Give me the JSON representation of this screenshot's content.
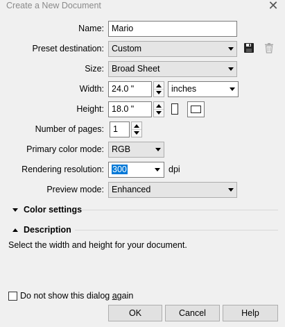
{
  "window": {
    "title": "Create a New Document",
    "close_glyph": "✕"
  },
  "form": {
    "name": {
      "label": "Name:",
      "value": "Mario"
    },
    "preset": {
      "label": "Preset destination:",
      "value": "Custom"
    },
    "size": {
      "label": "Size:",
      "value": "Broad Sheet"
    },
    "width": {
      "label": "Width:",
      "value": "24.0 \"",
      "unit": "inches"
    },
    "height": {
      "label": "Height:",
      "value": "18.0 \""
    },
    "pages": {
      "label": "Number of pages:",
      "value": "1"
    },
    "color_mode": {
      "label": "Primary color mode:",
      "value": "RGB"
    },
    "resolution": {
      "label": "Rendering resolution:",
      "value": "300",
      "unit": "dpi"
    },
    "preview": {
      "label": "Preview mode:",
      "value": "Enhanced"
    }
  },
  "sections": {
    "color_settings": "Color settings",
    "description": "Description",
    "description_text": "Select the width and height for your document."
  },
  "footer": {
    "dont_show": {
      "prefix": "Do not show this dialog ",
      "underlined": "a",
      "suffix": "gain"
    },
    "ok": "OK",
    "cancel": "Cancel",
    "help": "Help"
  },
  "icons": {
    "save_preset": "floppy-disk-icon",
    "delete_preset": "trash-icon",
    "portrait": "portrait-page-icon",
    "landscape": "landscape-page-icon"
  }
}
